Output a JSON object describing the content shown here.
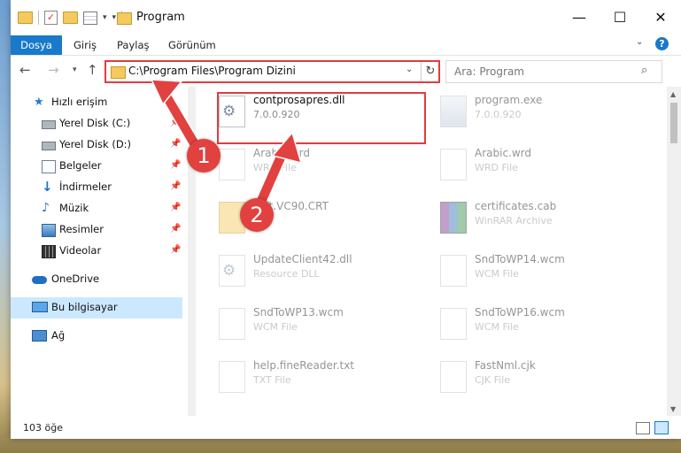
{
  "window": {
    "title": "Program",
    "controls": {
      "minimize": "—",
      "maximize": "☐",
      "close": "✕"
    }
  },
  "ribbon": {
    "tabs": [
      "Dosya",
      "Giriş",
      "Paylaş",
      "Görünüm"
    ],
    "help": "?"
  },
  "navigation": {
    "address_path": "C:\\Program Files\\Program Dizini",
    "search_placeholder": "Ara: Program"
  },
  "sidebar": {
    "items": [
      {
        "label": "Hızlı erişim",
        "icon": "star-icon"
      },
      {
        "label": "Yerel Disk (C:)",
        "icon": "drive-icon"
      },
      {
        "label": "Yerel Disk (D:)",
        "icon": "drive-icon"
      },
      {
        "label": "Belgeler",
        "icon": "documents-icon"
      },
      {
        "label": "İndirmeler",
        "icon": "download-icon"
      },
      {
        "label": "Müzik",
        "icon": "music-icon"
      },
      {
        "label": "Resimler",
        "icon": "pictures-icon"
      },
      {
        "label": "Videolar",
        "icon": "videos-icon"
      },
      {
        "label": "OneDrive",
        "icon": "cloud-icon"
      },
      {
        "label": "Bu bilgisayar",
        "icon": "computer-icon"
      },
      {
        "label": "Ağ",
        "icon": "network-icon"
      }
    ]
  },
  "files": [
    {
      "name": "contprosapres.dll",
      "sub": "7.0.0.920"
    },
    {
      "name": "program.exe",
      "sub": "7.0.0.920"
    },
    {
      "name": "Arabic.wrd",
      "sub": "WRD File"
    },
    {
      "name": "Arabic.wrd",
      "sub": "WRD File"
    },
    {
      "name": "soft.VC90.CRT",
      "sub": "920"
    },
    {
      "name": "certificates.cab",
      "sub": "WinRAR Archive"
    },
    {
      "name": "UpdateClient42.dll",
      "sub": "Resource DLL"
    },
    {
      "name": "SndToWP14.wcm",
      "sub": "WCM File"
    },
    {
      "name": "SndToWP13.wcm",
      "sub": "WCM File"
    },
    {
      "name": "SndToWP16.wcm",
      "sub": "WCM File"
    },
    {
      "name": "help.fineReader.txt",
      "sub": "TXT File"
    },
    {
      "name": "FastNml.cjk",
      "sub": "CJK File"
    }
  ],
  "status": {
    "item_count": "103 öğe"
  },
  "callouts": [
    "1",
    "2"
  ],
  "colors": {
    "accent": "#1979ca",
    "highlight": "#e23b3f"
  }
}
